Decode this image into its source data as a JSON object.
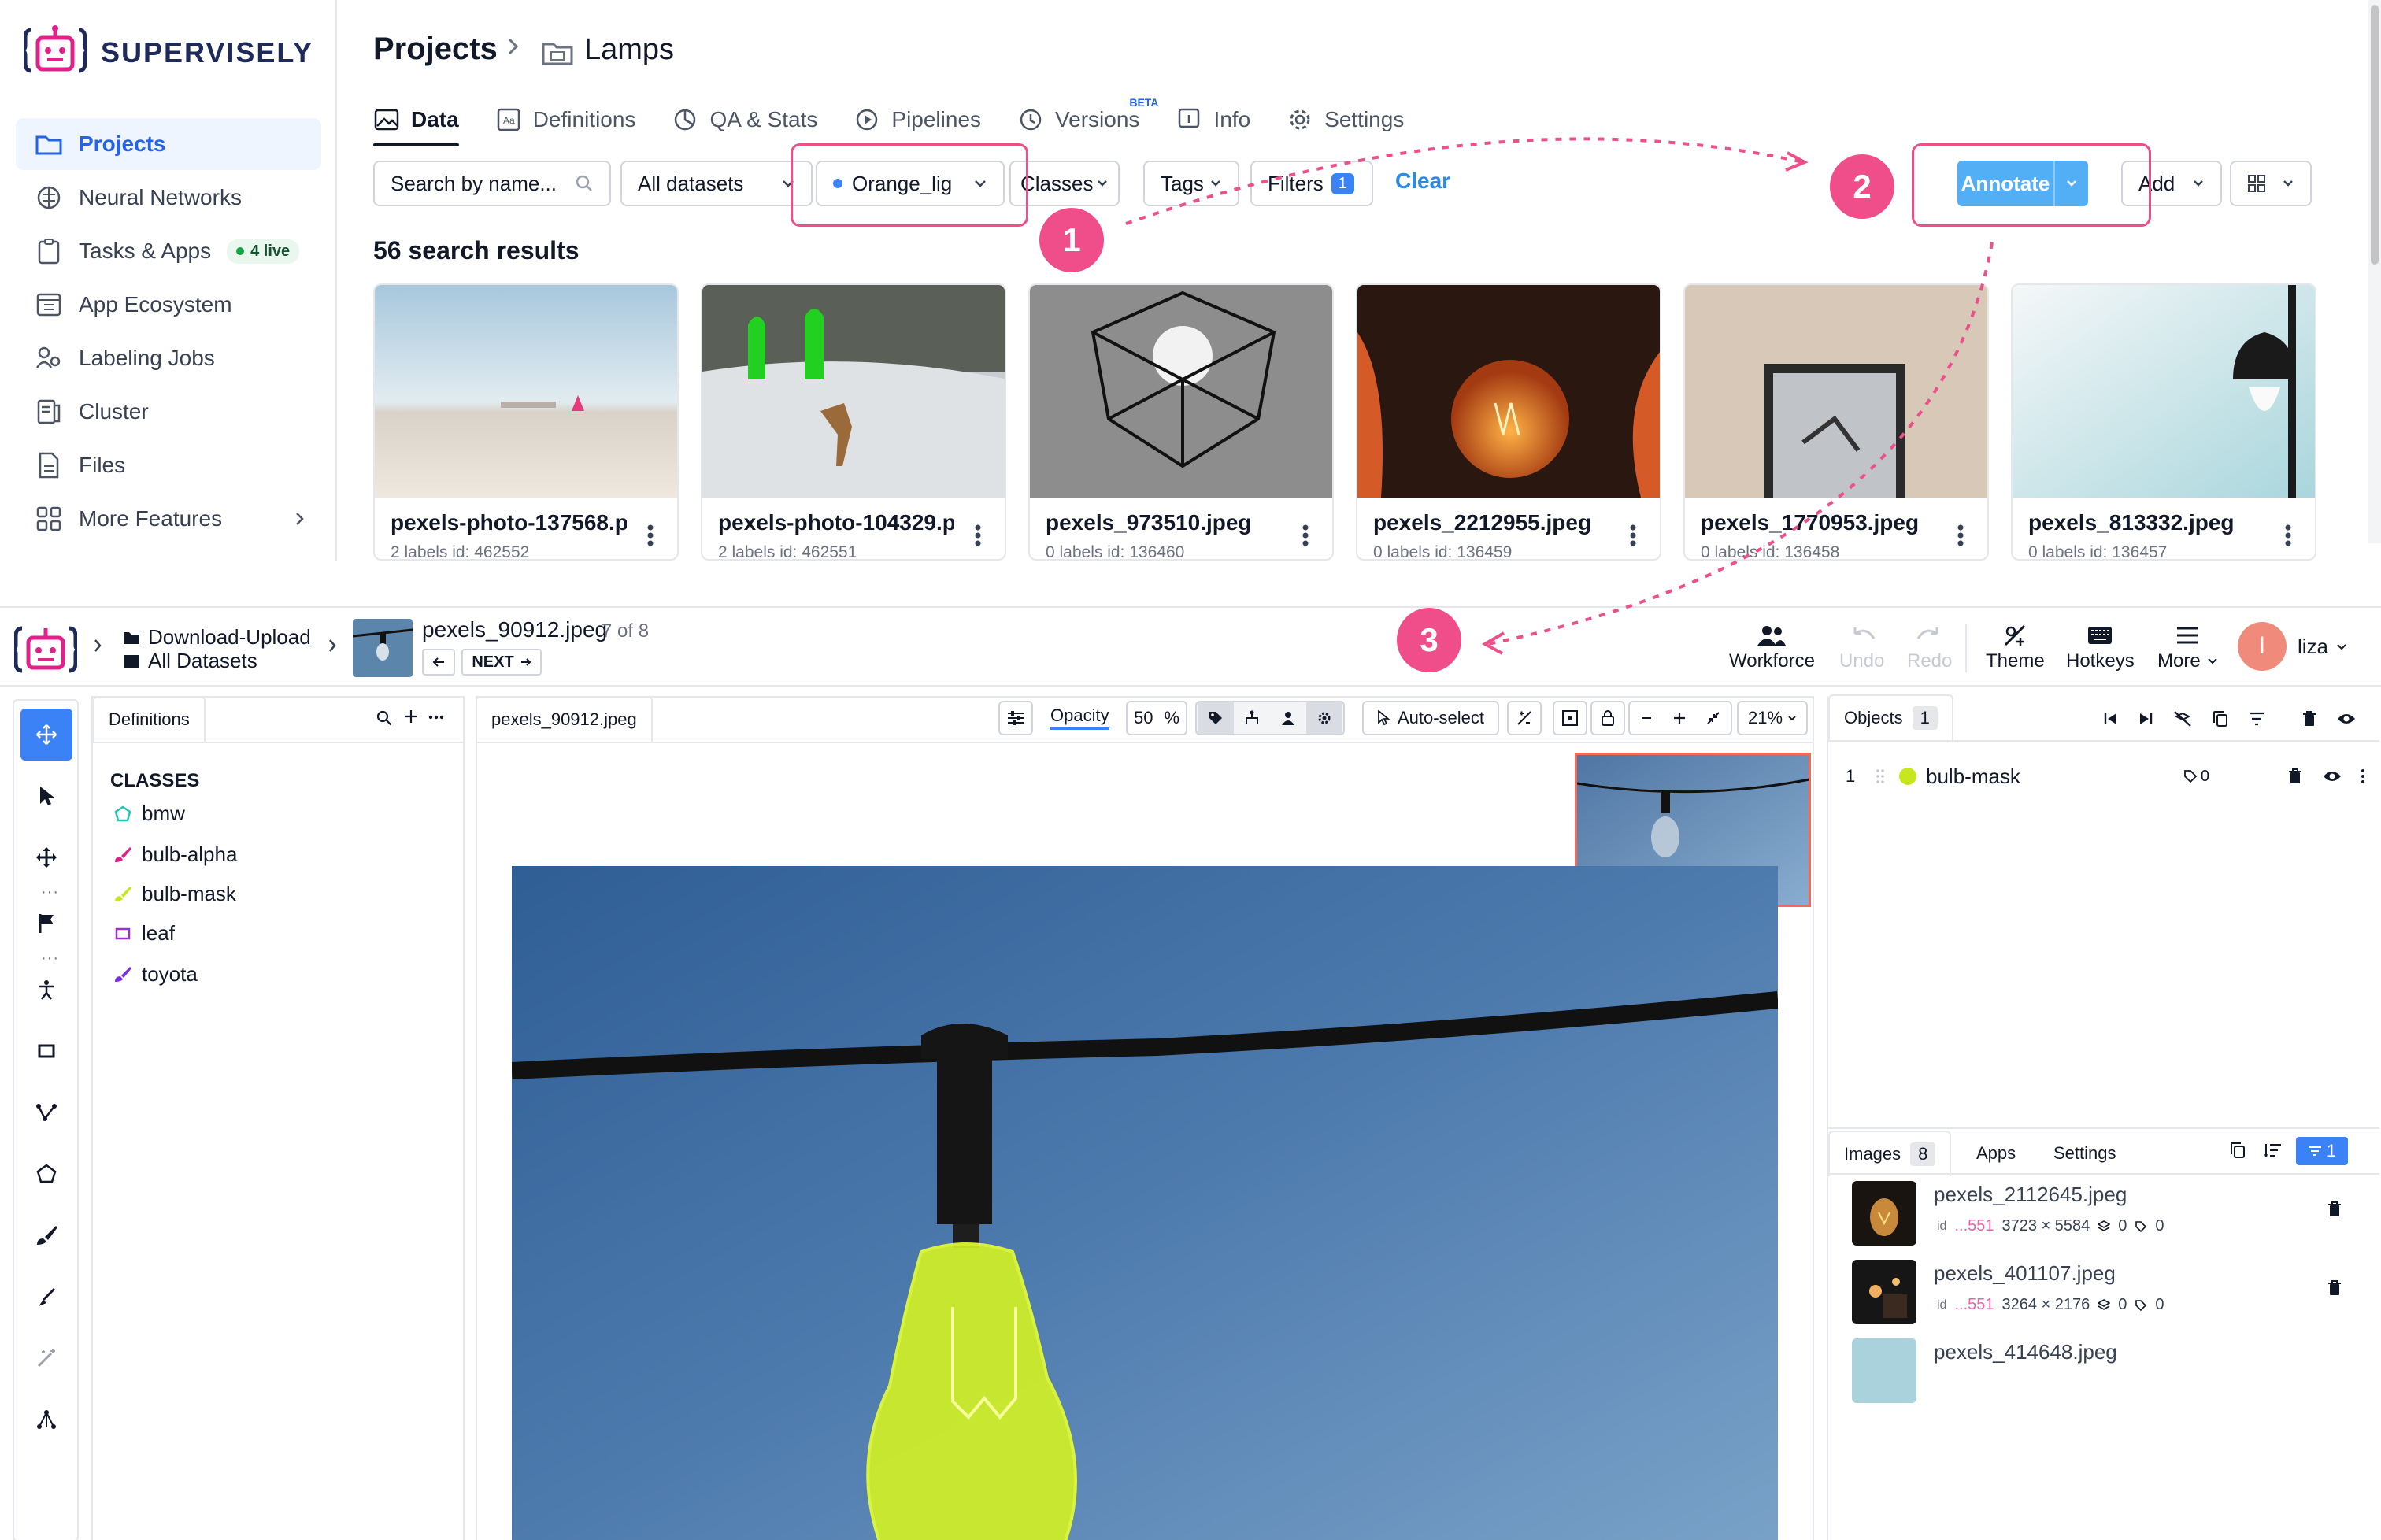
{
  "top": {
    "brand": "SUPERVISELY",
    "sidebar": [
      {
        "label": "Projects",
        "icon": "folder-icon",
        "active": true
      },
      {
        "label": "Neural Networks",
        "icon": "brain-icon"
      },
      {
        "label": "Tasks & Apps",
        "icon": "clipboard-icon",
        "badge": "4 live"
      },
      {
        "label": "App Ecosystem",
        "icon": "grid-window-icon"
      },
      {
        "label": "Labeling Jobs",
        "icon": "people-icon"
      },
      {
        "label": "Cluster",
        "icon": "server-icon"
      },
      {
        "label": "Files",
        "icon": "file-icon"
      },
      {
        "label": "More Features",
        "icon": "apps-icon"
      }
    ],
    "breadcrumb": {
      "root": "Projects",
      "sep": ">",
      "project": "Lamps"
    },
    "tabs": [
      {
        "label": "Data",
        "active": true
      },
      {
        "label": "Definitions"
      },
      {
        "label": "QA & Stats"
      },
      {
        "label": "Pipelines"
      },
      {
        "label": "Versions",
        "badge": "BETA"
      },
      {
        "label": "Info"
      },
      {
        "label": "Settings"
      }
    ],
    "filters": {
      "search_placeholder": "Search by name...",
      "datasets": "All datasets",
      "tag_filter": "Orange_lig",
      "classes": "Classes",
      "tags": "Tags",
      "filters": "Filters",
      "filters_count": "1",
      "clear": "Clear"
    },
    "actions": {
      "annotate": "Annotate",
      "add": "Add"
    },
    "results_title": "56 search results",
    "cards": [
      {
        "name": "pexels-photo-137568.p",
        "meta": "2 labels  id: 462552"
      },
      {
        "name": "pexels-photo-104329.p",
        "meta": "2 labels  id: 462551"
      },
      {
        "name": "pexels_973510.jpeg",
        "meta": "0 labels  id: 136460"
      },
      {
        "name": "pexels_2212955.jpeg",
        "meta": "0 labels  id: 136459"
      },
      {
        "name": "pexels_1770953.jpeg",
        "meta": "0 labels  id: 136458"
      },
      {
        "name": "pexels_813332.jpeg",
        "meta": "0 labels  id: 136457"
      }
    ],
    "steps": [
      "1",
      "2",
      "3"
    ]
  },
  "bottom": {
    "project_line1": "Download-Upload",
    "project_line2": "All Datasets",
    "image_name": "pexels_90912.jpeg",
    "image_pos": "7 of 8",
    "next": "NEXT",
    "header_buttons": [
      {
        "label": "Workforce",
        "icon": "people-icon"
      },
      {
        "label": "Undo",
        "icon": "undo-icon",
        "disabled": true
      },
      {
        "label": "Redo",
        "icon": "redo-icon",
        "disabled": true
      },
      {
        "label": "Theme",
        "icon": "theme-icon"
      },
      {
        "label": "Hotkeys",
        "icon": "keyboard-icon"
      },
      {
        "label": "More",
        "icon": "menu-icon"
      }
    ],
    "user": {
      "initial": "l",
      "name": "liza",
      "color": "#f08a7a"
    },
    "definitions_tab": "Definitions",
    "classes_title": "CLASSES",
    "classes": [
      {
        "name": "bmw",
        "color": "#22c3b0",
        "shape": "polygon"
      },
      {
        "name": "bulb-alpha",
        "color": "#e0218a",
        "shape": "brush"
      },
      {
        "name": "bulb-mask",
        "color": "#c8e61e",
        "shape": "brush"
      },
      {
        "name": "leaf",
        "color": "#9b30d9",
        "shape": "rect"
      },
      {
        "name": "toyota",
        "color": "#7a2ee0",
        "shape": "brush"
      }
    ],
    "canvas_tab": "pexels_90912.jpeg",
    "opacity_label": "Opacity",
    "opacity_value": "50",
    "opacity_unit": "%",
    "auto_select": "Auto-select",
    "zoom": "21%",
    "objects_tab": "Objects",
    "objects_count": "1",
    "objects": [
      {
        "index": "1",
        "name": "bulb-mask",
        "color": "#c8e61e",
        "tags": "0"
      }
    ],
    "bottom_tabs": {
      "images": "Images",
      "images_count": "8",
      "apps": "Apps",
      "settings": "Settings",
      "filter_count": "1"
    },
    "images": [
      {
        "name": "pexels_2112645.jpeg",
        "id": "...551",
        "size": "3723 × 5584",
        "layers": "0",
        "tags": "0"
      },
      {
        "name": "pexels_401107.jpeg",
        "id": "...551",
        "size": "3264 × 2176",
        "layers": "0",
        "tags": "0"
      },
      {
        "name": "pexels_414648.jpeg",
        "id": "",
        "size": "",
        "layers": "",
        "tags": ""
      }
    ]
  },
  "colors": {
    "accent": "#3b82f6",
    "highlight": "#ec4f8a",
    "brand": "#1e2a5a",
    "mask": "#c8e61e"
  }
}
